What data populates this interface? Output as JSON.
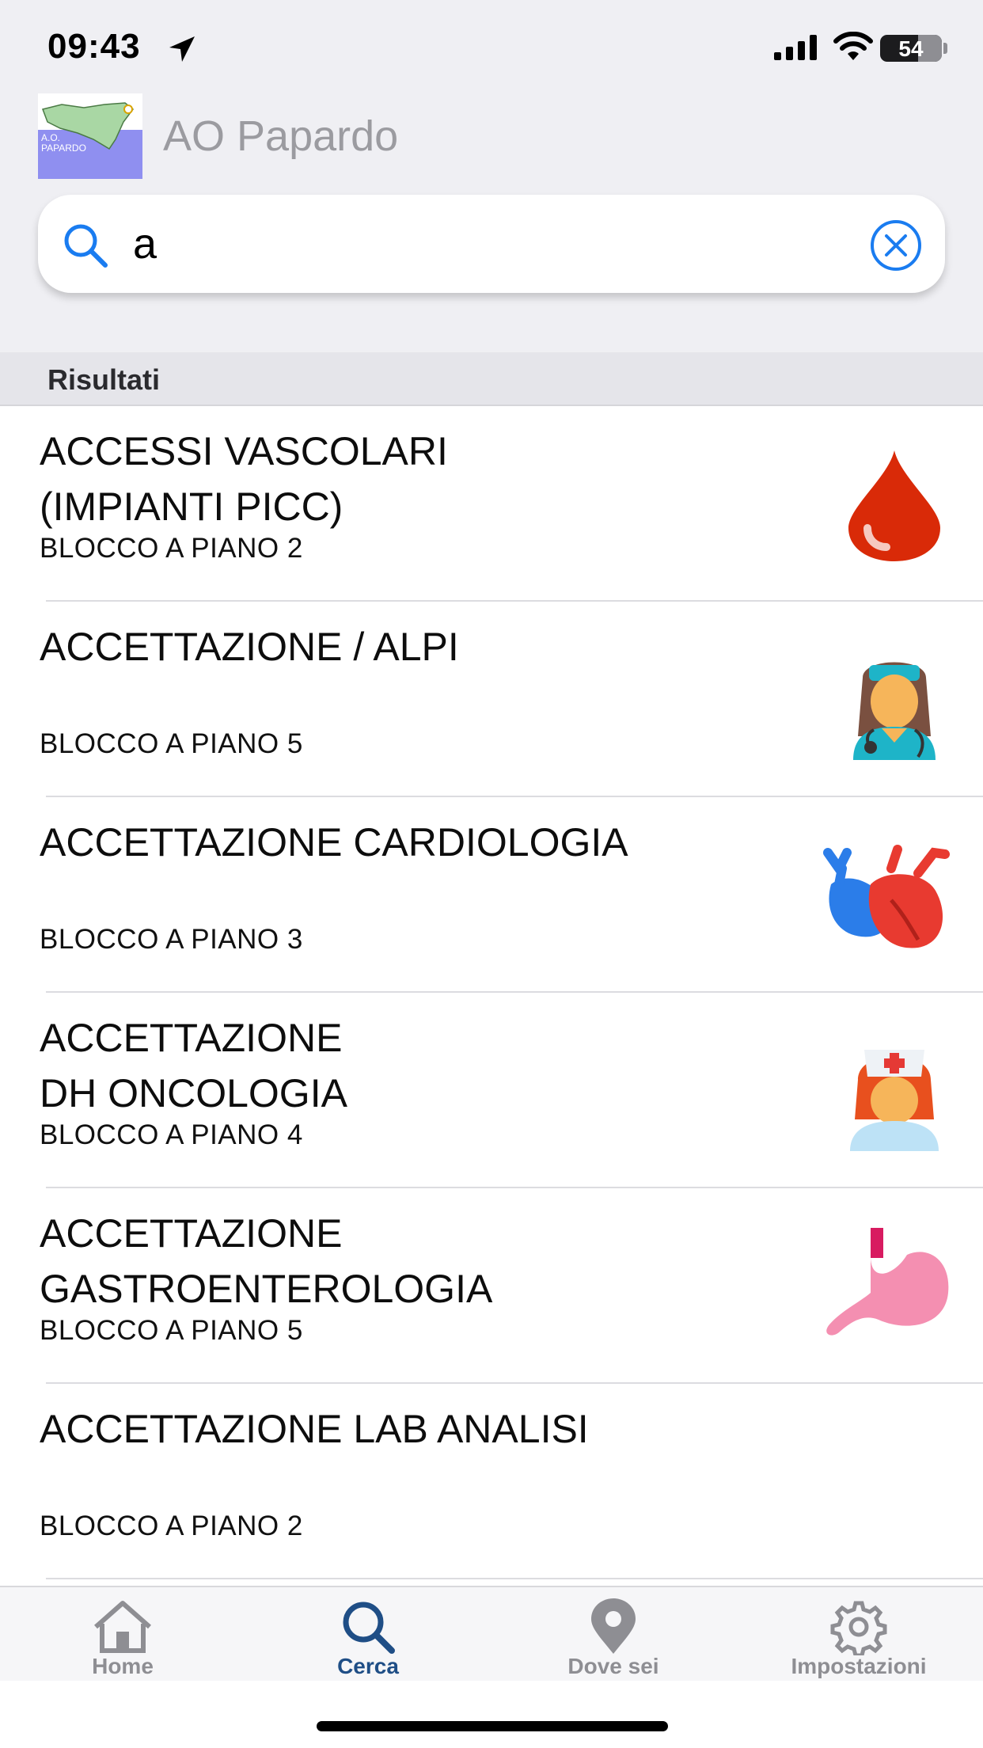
{
  "status_bar": {
    "time": "09:43",
    "battery": "54"
  },
  "header": {
    "app_name": "AO Papardo",
    "logo_text": "A.O.\nPAPARDO"
  },
  "search": {
    "value": "a",
    "placeholder": ""
  },
  "section_header": "Risultati",
  "results": [
    {
      "title": "ACCESSI VASCOLARI\n(IMPIANTI PICC)",
      "location": "BLOCCO A PIANO 2",
      "icon": "blood-drop-icon"
    },
    {
      "title": "ACCETTAZIONE / ALPI",
      "location": "BLOCCO A PIANO 5",
      "icon": "doctor-icon"
    },
    {
      "title": "ACCETTAZIONE CARDIOLOGIA",
      "location": "BLOCCO A PIANO 3",
      "icon": "heart-icon"
    },
    {
      "title": "ACCETTAZIONE\nDH ONCOLOGIA",
      "location": "BLOCCO A PIANO 4",
      "icon": "nurse-icon"
    },
    {
      "title": "ACCETTAZIONE\nGASTROENTEROLOGIA",
      "location": "BLOCCO A PIANO 5",
      "icon": "stomach-icon"
    },
    {
      "title": "ACCETTAZIONE LAB ANALISI",
      "location": "BLOCCO A PIANO 2",
      "icon": ""
    }
  ],
  "tabbar": {
    "items": [
      {
        "label": "Home",
        "icon": "home-icon",
        "active": false
      },
      {
        "label": "Cerca",
        "icon": "search-icon",
        "active": true
      },
      {
        "label": "Dove sei",
        "icon": "location-pin-icon",
        "active": false
      },
      {
        "label": "Impostazioni",
        "icon": "gear-icon",
        "active": false
      }
    ]
  },
  "colors": {
    "accent": "#1f4e86",
    "search_icon": "#1a7cf0",
    "inactive": "#8e8e93"
  }
}
